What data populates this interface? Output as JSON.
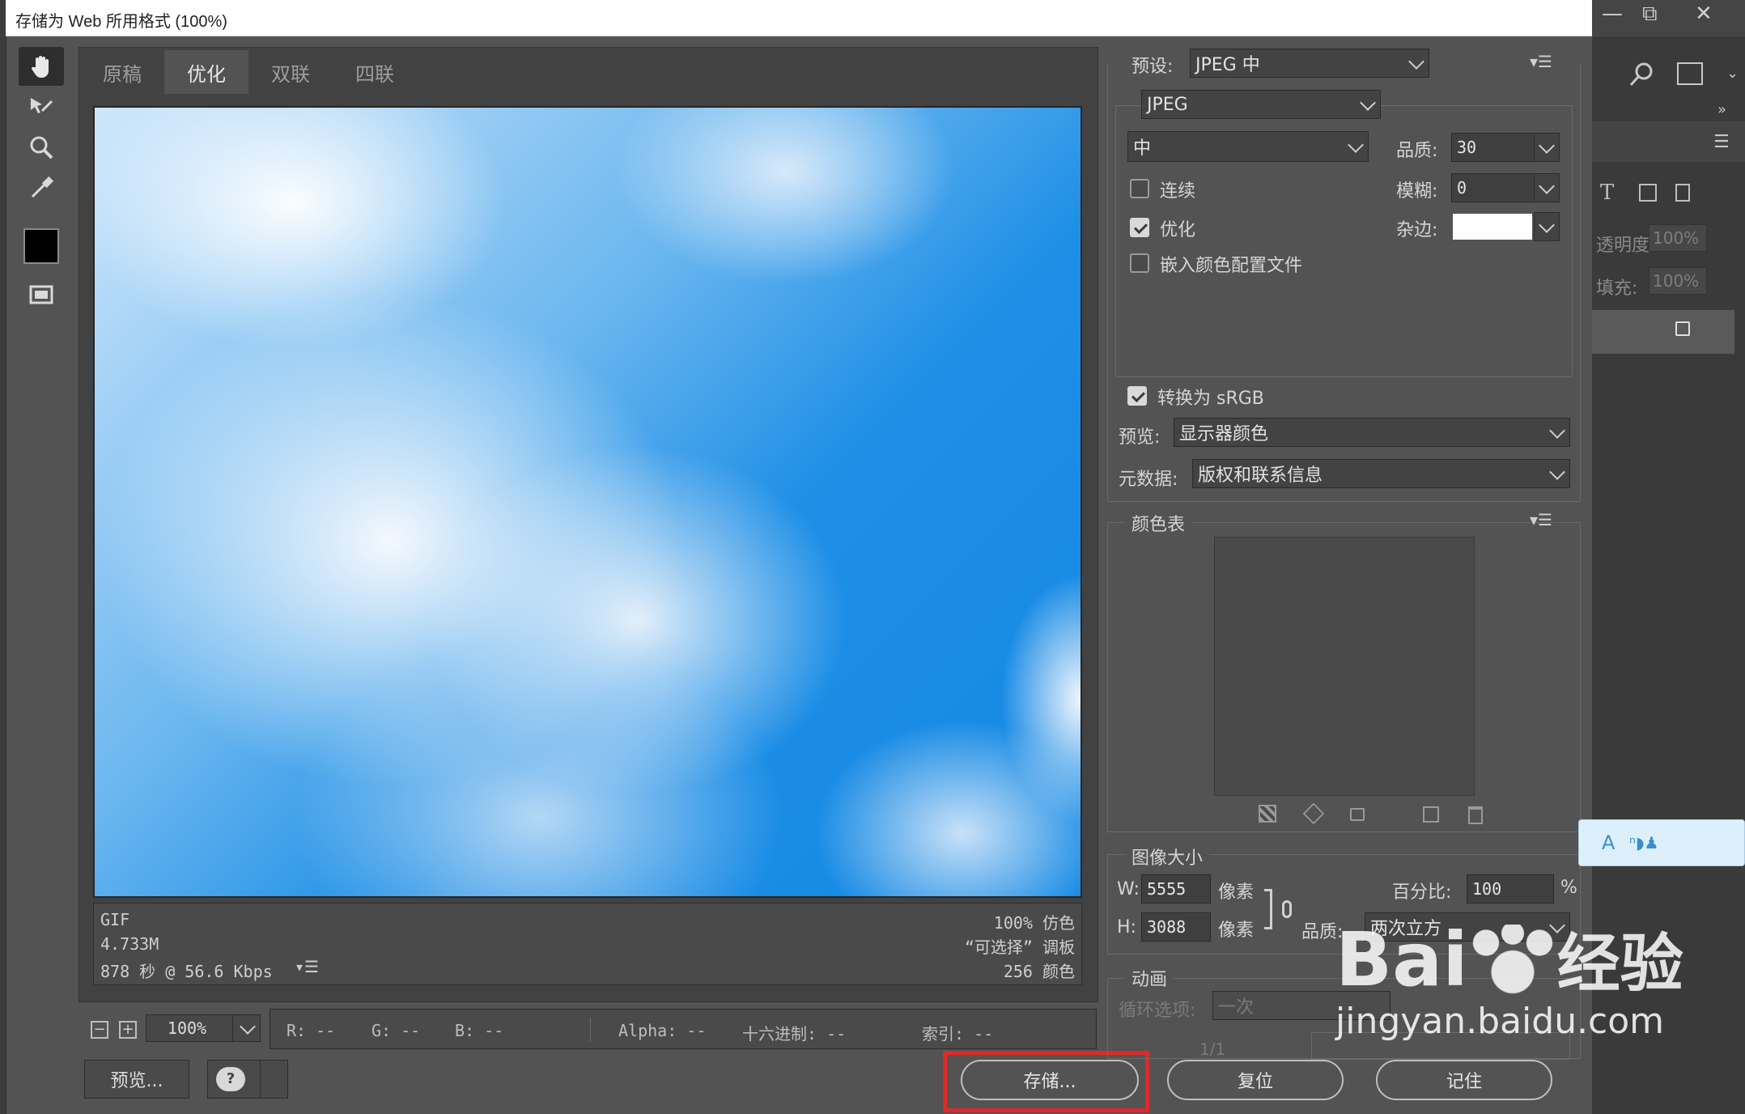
{
  "window": {
    "title": "存储为 Web 所用格式 (100%)",
    "controls": {
      "minimize": "—",
      "restore": "⧉",
      "close": "✕"
    }
  },
  "tools": [
    {
      "name": "hand-tool",
      "icon": "hand-icon"
    },
    {
      "name": "slice-select-tool",
      "icon": "slice-select-icon"
    },
    {
      "name": "zoom-tool",
      "icon": "zoom-icon"
    },
    {
      "name": "eyedropper-tool",
      "icon": "eyedropper-icon"
    },
    {
      "name": "eyedropper-color",
      "icon": "color-swatch"
    },
    {
      "name": "toggle-slices",
      "icon": "slices-icon"
    }
  ],
  "tabs": [
    {
      "label": "原稿",
      "active": false
    },
    {
      "label": "优化",
      "active": true
    },
    {
      "label": "双联",
      "active": false
    },
    {
      "label": "四联",
      "active": false
    }
  ],
  "image_info": {
    "format": "GIF",
    "size": "4.733M",
    "time": "878 秒 @ 56.6 Kbps",
    "dither": "100% 仿色",
    "palette": "“可选择” 调板",
    "colors": "256 颜色"
  },
  "status": {
    "zoom": "100%",
    "r": "R: --",
    "g": "G: --",
    "b": "B: --",
    "alpha": "Alpha: --",
    "hex": "十六进制: --",
    "index": "索引: --"
  },
  "buttons": {
    "preview": "预览...",
    "save": "存储...",
    "reset": "复位",
    "remember": "记住"
  },
  "settings": {
    "preset_label": "预设:",
    "preset_value": "JPEG 中",
    "format_value": "JPEG",
    "quality_preset": "中",
    "quality_label": "品质:",
    "quality_value": "30",
    "blur_label": "模糊:",
    "blur_value": "0",
    "matte_label": "杂边:",
    "progressive_label": "连续",
    "progressive_checked": false,
    "optimized_label": "优化",
    "optimized_checked": true,
    "embed_profile_label": "嵌入颜色配置文件",
    "embed_profile_checked": false,
    "convert_srgb_label": "转换为 sRGB",
    "convert_srgb_checked": true,
    "preview_label": "预览:",
    "preview_value": "显示器颜色",
    "metadata_label": "元数据:",
    "metadata_value": "版权和联系信息"
  },
  "color_table": {
    "title": "颜色表"
  },
  "image_size": {
    "title": "图像大小",
    "w_label": "W:",
    "w_value": "5555",
    "h_label": "H:",
    "h_value": "3088",
    "unit": "像素",
    "percent_label": "百分比:",
    "percent_value": "100",
    "percent_unit": "%",
    "quality_label": "品质:",
    "quality_value": "两次立方"
  },
  "animation": {
    "title": "动画",
    "loop_label": "循环选项:",
    "loop_value": "一次",
    "frame_counter": "1/1"
  },
  "background_panel": {
    "opacity_label": "透明度:",
    "opacity_value": "100%",
    "fill_label": "填充:",
    "fill_value": "100%"
  },
  "watermark": {
    "brand": "Bai",
    "brand_tail": "经验",
    "url": "jingyan.baidu.com"
  }
}
